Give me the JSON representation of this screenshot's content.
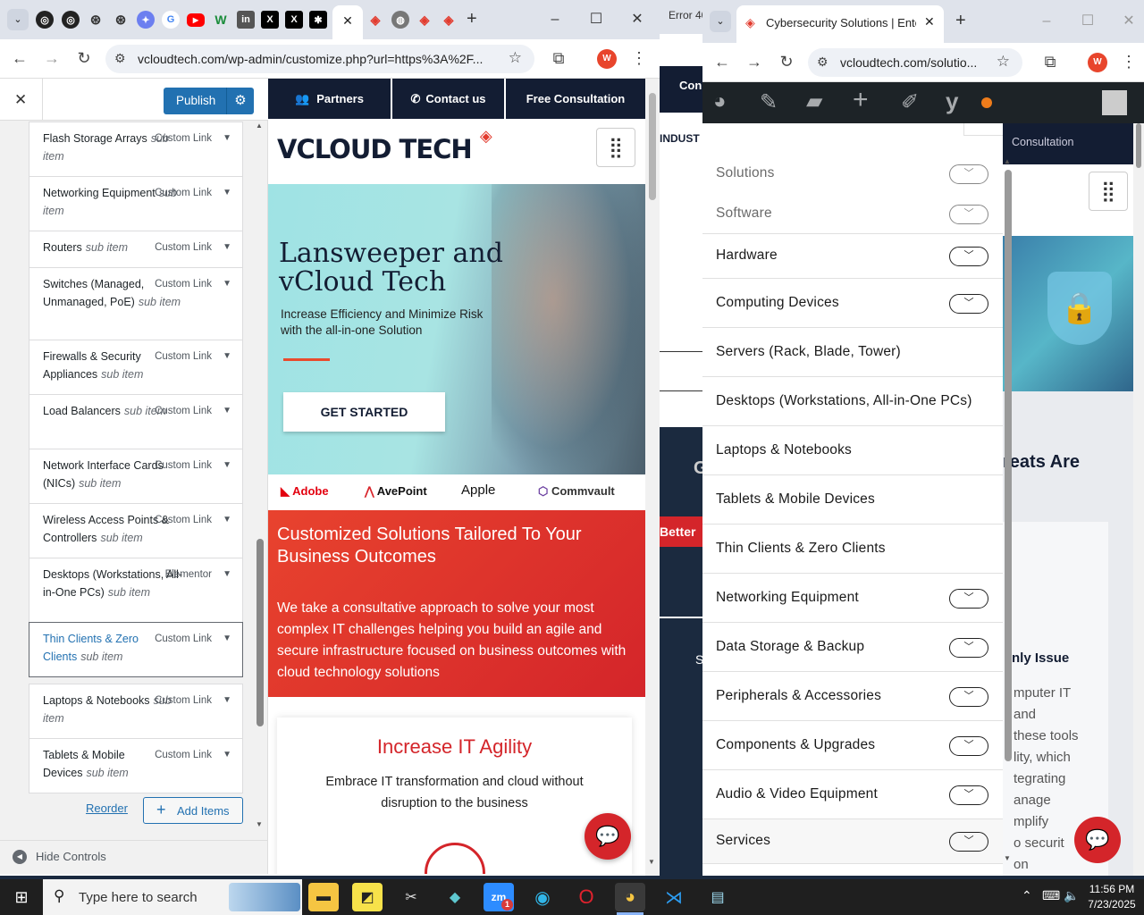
{
  "left_window": {
    "tab_label": "",
    "url": "vcloudtech.com/wp-admin/customize.php?url=https%3A%2F...",
    "profile_letter": "W"
  },
  "customizer": {
    "publish_label": "Publish",
    "close_glyph": "✕",
    "items": [
      {
        "label": "Flash Storage Arrays",
        "sub": "sub item",
        "type": "Custom Link"
      },
      {
        "label": "Networking Equipment",
        "sub": "sub item",
        "type": "Custom Link"
      },
      {
        "label": "Routers",
        "sub": "sub item",
        "type": "Custom Link"
      },
      {
        "label": "Switches (Managed, Unmanaged, PoE)",
        "sub": "sub item",
        "type": "Custom Link"
      },
      {
        "label": "Firewalls & Security Appliances",
        "sub": "sub item",
        "type": "Custom Link"
      },
      {
        "label": "Load Balancers",
        "sub": "sub item",
        "type": "Custom Link"
      },
      {
        "label": "Network Interface Cards (NICs)",
        "sub": "sub item",
        "type": "Custom Link"
      },
      {
        "label": "Wireless Access Points & Controllers",
        "sub": "sub item",
        "type": "Custom Link"
      },
      {
        "label": "Desktops (Workstations, All-in-One PCs)",
        "sub": "sub item",
        "type": "Elementor"
      },
      {
        "label": "Thin Clients & Zero Clients",
        "sub": "sub item",
        "type": "Custom Link"
      },
      {
        "label": "Laptops & Notebooks",
        "sub": "sub item",
        "type": "Custom Link"
      },
      {
        "label": "Tablets & Mobile Devices",
        "sub": "sub item",
        "type": "Custom Link"
      }
    ],
    "reorder_label": "Reorder",
    "add_items_label": "Add Items",
    "hide_controls_label": "Hide Controls"
  },
  "preview": {
    "nav_partners": "Partners",
    "nav_contact": "Contact us",
    "nav_consult": "Free Consultation",
    "logo": "VCLOUD TECH",
    "hero_title_1": "Lansweeper and",
    "hero_title_2": "vCloud Tech",
    "hero_sub_1": "Increase Efficiency and Minimize Risk",
    "hero_sub_2": "with the all-in-one Solution",
    "cta": "GET STARTED",
    "brands": [
      "Adobe",
      "AvePoint",
      "Apple",
      "Commvault"
    ],
    "red_title_1": "Customized Solutions Tailored To Your",
    "red_title_2": "Business Outcomes",
    "red_body": "We take a consultative approach to solve your most complex IT challenges helping you build an agile and secure infrastructure focused on business outcomes with cloud technology solutions",
    "card_title": "Increase IT Agility",
    "card_body_1": "Embrace IT transformation and cloud without",
    "card_body_2": "disruption to the business"
  },
  "middle_window": {
    "tab_text": "Error 40",
    "nav_text": "Con",
    "indust_text": "INDUST",
    "g_text": "G",
    "better_text": "Better",
    "s_text": "S"
  },
  "right_window": {
    "tab_title": "Cybersecurity Solutions | Enterp",
    "url": "vcloudtech.com/solutio...",
    "profile_letter": "W",
    "bg_consult": "Consultation",
    "bg_heading": "reats Are",
    "bg_issue": "nly Issue",
    "bg_lines": [
      "mputer IT",
      "and",
      "these tools",
      "lity, which",
      "tegrating",
      "anage",
      "mplify",
      "o securit",
      "on"
    ],
    "menu": [
      {
        "label": "Solutions",
        "chevron": true,
        "faded": true
      },
      {
        "label": "Software",
        "chevron": true,
        "faded": true
      },
      {
        "label": "Hardware",
        "chevron": true
      },
      {
        "label": "Computing Devices",
        "chevron": true
      },
      {
        "label": "Servers (Rack, Blade, Tower)",
        "chevron": false
      },
      {
        "label": "Desktops (Workstations, All-in-One PCs)",
        "chevron": false
      },
      {
        "label": "Laptops & Notebooks",
        "chevron": false
      },
      {
        "label": "Tablets & Mobile Devices",
        "chevron": false
      },
      {
        "label": "Thin Clients & Zero Clients",
        "chevron": false
      },
      {
        "label": "Networking Equipment",
        "chevron": true
      },
      {
        "label": "Data Storage & Backup",
        "chevron": true
      },
      {
        "label": "Peripherals & Accessories",
        "chevron": true
      },
      {
        "label": "Components & Upgrades",
        "chevron": true
      },
      {
        "label": "Audio & Video Equipment",
        "chevron": true
      },
      {
        "label": "Services",
        "chevron": true
      }
    ]
  },
  "taskbar": {
    "search_placeholder": "Type here to search",
    "time": "11:56 PM",
    "date": "7/23/2025",
    "zoom_badge": "1"
  },
  "colors": {
    "accent_blue": "#2271b1",
    "brand_red": "#e23b2e",
    "navy": "#131d33"
  }
}
